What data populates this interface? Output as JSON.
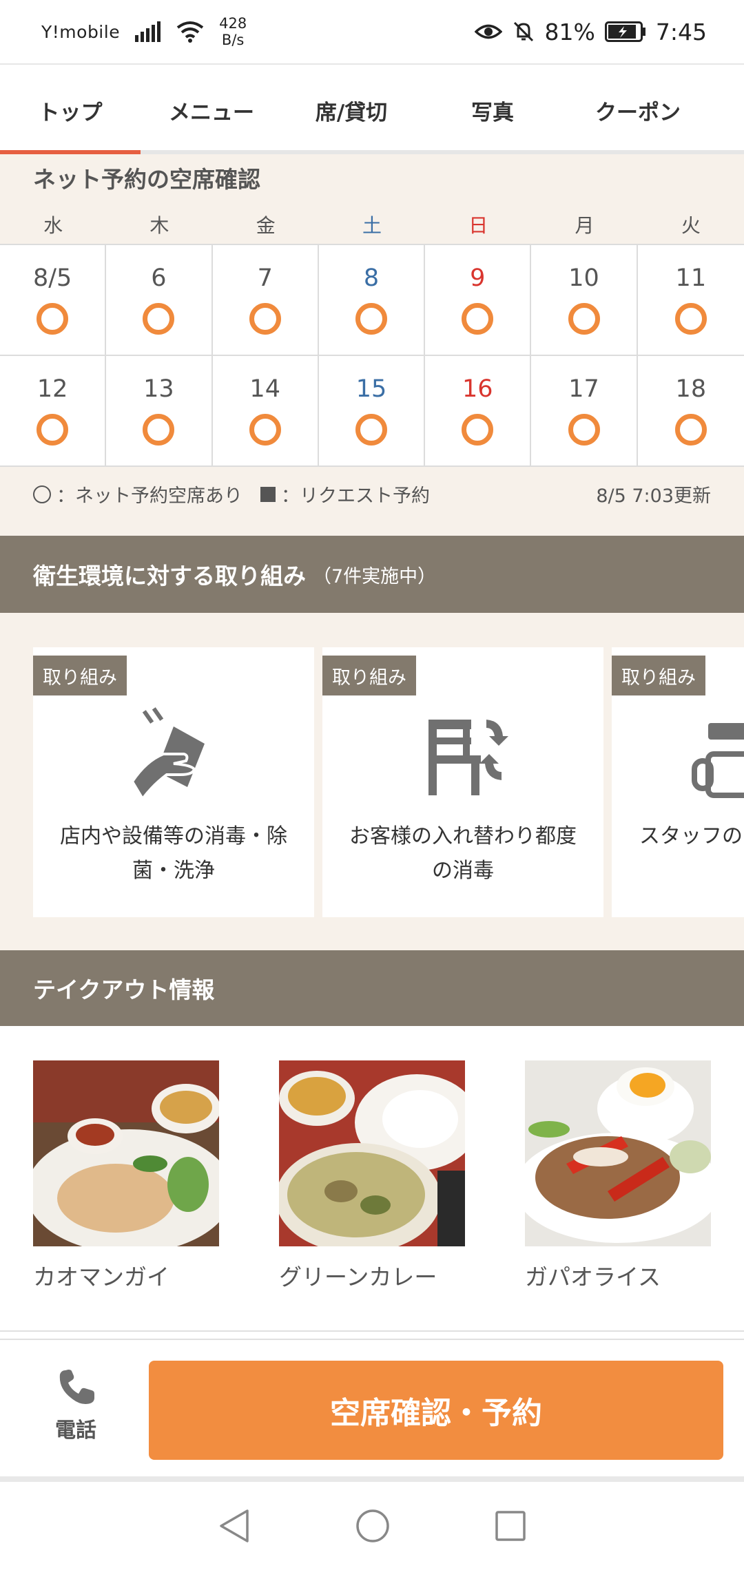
{
  "status_bar": {
    "carrier": "Y!mobile",
    "speed_value": "428",
    "speed_unit": "B/s",
    "battery": "81%",
    "time": "7:45"
  },
  "tabs": [
    {
      "label": "トップ",
      "active": true
    },
    {
      "label": "メニュー",
      "active": false
    },
    {
      "label": "席/貸切",
      "active": false
    },
    {
      "label": "写真",
      "active": false
    },
    {
      "label": "クーポン",
      "active": false
    }
  ],
  "calendar": {
    "title": "ネット予約の空席確認",
    "weekdays": [
      "水",
      "木",
      "金",
      "土",
      "日",
      "月",
      "火"
    ],
    "rows": [
      [
        "8/5",
        "6",
        "7",
        "8",
        "9",
        "10",
        "11"
      ],
      [
        "12",
        "13",
        "14",
        "15",
        "16",
        "17",
        "18"
      ]
    ],
    "legend_available": "：ネット予約空席あり",
    "legend_request": "：リクエスト予約",
    "updated": "8/5  7:03更新"
  },
  "hygiene": {
    "title": "衛生環境に対する取り組み",
    "count": "（7件実施中）",
    "cards": [
      {
        "tag": "取り組み",
        "text": "店内や設備等の消毒・除菌・洗浄",
        "icon": "disinfect-icon"
      },
      {
        "tag": "取り組み",
        "text": "お客様の入れ替わり都度の消毒",
        "icon": "chair-swap-icon"
      },
      {
        "tag": "取り組み",
        "text": "スタッフの",
        "icon": "staff-icon"
      }
    ]
  },
  "takeout": {
    "title": "テイクアウト情報",
    "items": [
      {
        "name": "カオマンガイ"
      },
      {
        "name": "グリーンカレー"
      },
      {
        "name": "ガパオライス"
      }
    ]
  },
  "action_bar": {
    "phone_label": "電話",
    "reserve_label": "空席確認・予約"
  },
  "colors": {
    "accent": "#f28d40",
    "tab_active": "#e65f41",
    "section_header": "#837a6d",
    "saturday": "#3a6ea5",
    "sunday": "#d9352e"
  }
}
